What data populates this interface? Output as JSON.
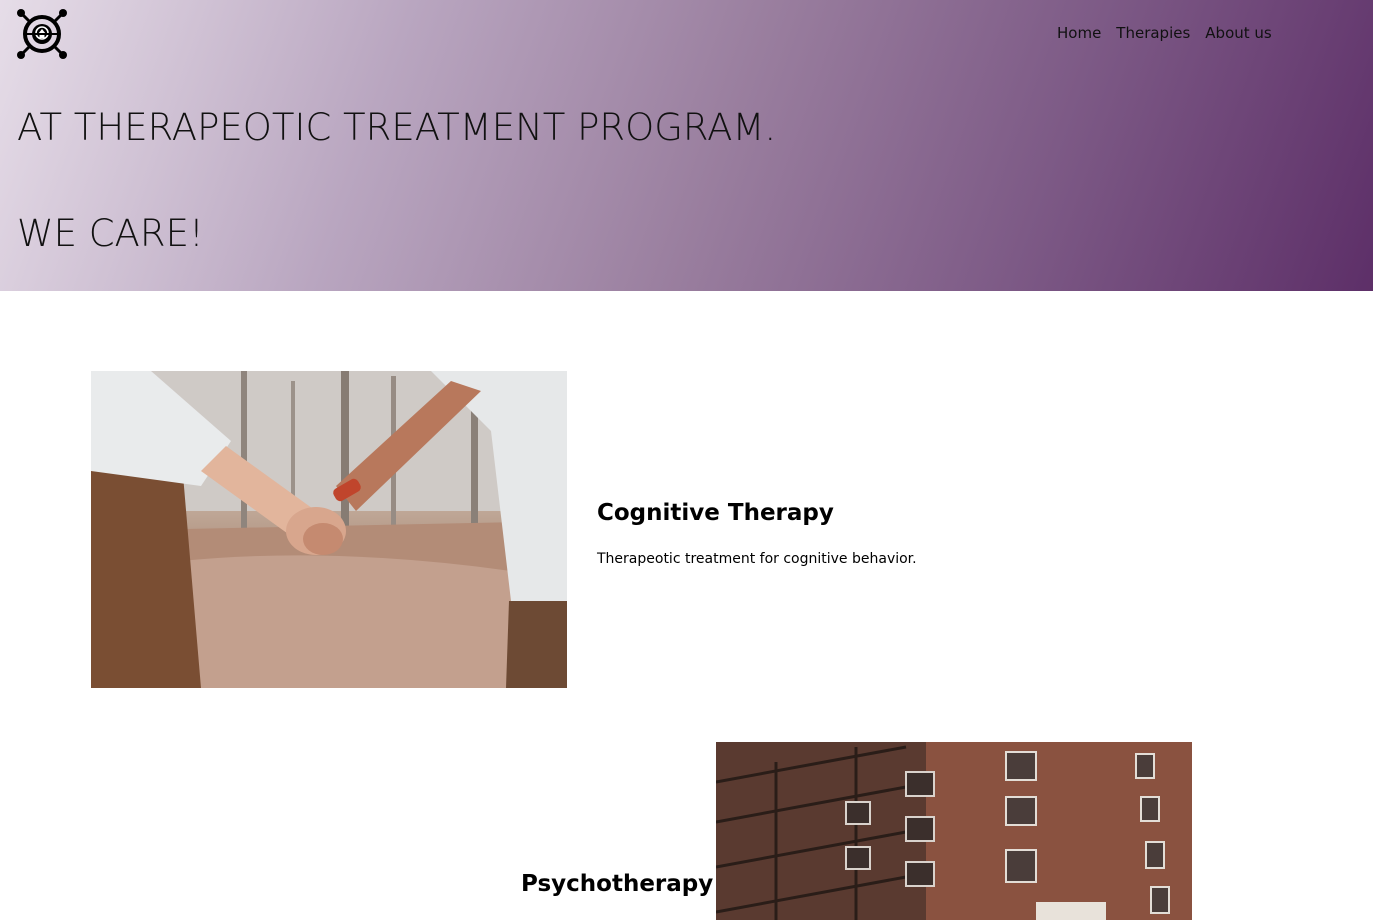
{
  "nav": {
    "items": [
      "Home",
      "Therapies",
      "About us"
    ]
  },
  "hero": {
    "line1": "AT THERAPEOTIC TREATMENT PROGRAM.",
    "line2": "WE CARE!"
  },
  "therapies": [
    {
      "title": "Cognitive Therapy",
      "description": "Therapeotic treatment for cognitive behavior."
    },
    {
      "title": "Psychotherapy"
    }
  ],
  "colors": {
    "hero_start": "#e6dde8",
    "hero_end": "#5d2f68",
    "text": "#111111"
  },
  "icons": {
    "logo": "brain-globe-logo-icon"
  }
}
